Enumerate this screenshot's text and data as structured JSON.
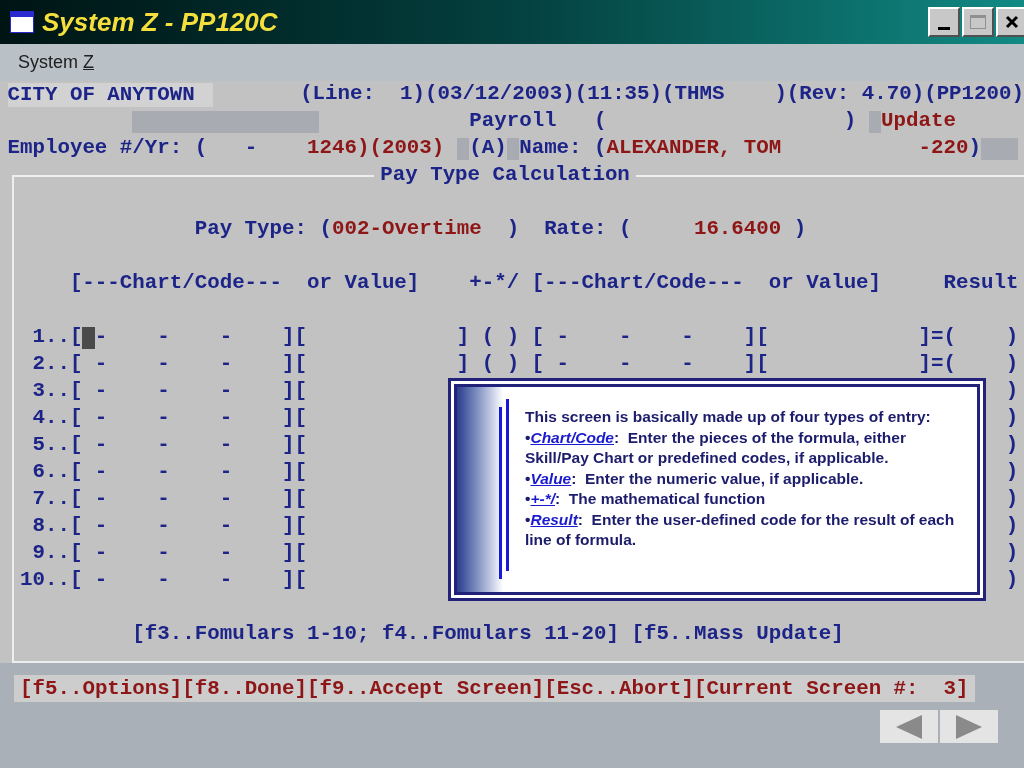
{
  "window": {
    "title": "System Z - PP120C"
  },
  "menu": [
    {
      "label": "System ",
      "mnemonic": "Z"
    }
  ],
  "header": {
    "organization": "CITY OF ANYTOWN",
    "info": "(Line:  1)(03/12/2003)(11:35)(THMS    )(Rev: 4.70)(PP1200)",
    "module": "Payroll",
    "module_open": "(",
    "module_close": ")",
    "mode": "Update"
  },
  "employee": {
    "label": "Employee #/Yr: (",
    "separator": "-",
    "number": "1246)(2003)",
    "status": "(A)",
    "name_label": "Name: (",
    "name": "ALEXANDER, TOM",
    "code": "-220",
    "close": ")"
  },
  "section": {
    "title": "Pay Type Calculation",
    "pay_type_label": "Pay Type: (",
    "pay_type": "002-Overtime",
    "pay_type_close": ")",
    "rate_label": "Rate: (",
    "rate": "16.6400",
    "rate_close": ")"
  },
  "columns": [
    "[---Chart/Code---  or Value]",
    "+-*/",
    "[---Chart/Code---  or Value]",
    "Result"
  ],
  "rows": [
    {
      "label": "1..[",
      "cursor": true,
      "left": [
        "-",
        "-",
        "-",
        "]["
      ],
      "right": [
        "]",
        "(",
        ")",
        "[",
        "-",
        "-",
        "-",
        "][",
        "]=(",
        ")"
      ]
    },
    {
      "label": "2..[",
      "cursor": false,
      "left": [
        "-",
        "-",
        "-",
        "]["
      ],
      "right": [
        "]",
        "(",
        ")",
        "[",
        "-",
        "-",
        "-",
        "][",
        "]=(",
        ")"
      ]
    },
    {
      "label": "3..[",
      "cursor": false,
      "left": [
        "-",
        "-",
        "-",
        "]["
      ],
      "right": [
        ")"
      ]
    },
    {
      "label": "4..[",
      "cursor": false,
      "left": [
        "-",
        "-",
        "-",
        "]["
      ],
      "right": [
        ")"
      ]
    },
    {
      "label": "5..[",
      "cursor": false,
      "left": [
        "-",
        "-",
        "-",
        "]["
      ],
      "right": [
        ")"
      ]
    },
    {
      "label": "6..[",
      "cursor": false,
      "left": [
        "-",
        "-",
        "-",
        "]["
      ],
      "right": [
        ")"
      ]
    },
    {
      "label": "7..[",
      "cursor": false,
      "left": [
        "-",
        "-",
        "-",
        "]["
      ],
      "right": [
        ")"
      ]
    },
    {
      "label": "8..[",
      "cursor": false,
      "left": [
        "-",
        "-",
        "-",
        "]["
      ],
      "right": [
        ")"
      ]
    },
    {
      "label": "9..[",
      "cursor": false,
      "left": [
        "-",
        "-",
        "-",
        "]["
      ],
      "right": [
        ")"
      ]
    },
    {
      "label": "10..[",
      "cursor": false,
      "left": [
        "-",
        "-",
        "-",
        "]["
      ],
      "right": [
        ")"
      ]
    }
  ],
  "function_keys": "[f3..Fomulars 1-10; f4..Fomulars 11-20] [f5..Mass Update]",
  "status_bar": "[f5..Options][f8..Done][f9..Accept Screen][Esc..Abort][Current Screen #:  3]",
  "callout": {
    "intro": "This screen is basically made up of four types of entry:",
    "bullets": [
      {
        "bullet": "•",
        "term": "Chart/Code",
        "text": ":  Enter the pieces of the formula, either Skill/Pay Chart or predefined codes, if applicable."
      },
      {
        "bullet": "•",
        "term": "Value",
        "text": ":  Enter the numeric value, if applicable."
      },
      {
        "bullet": "•",
        "term": "+-*/",
        "text": ":  The mathematical function"
      },
      {
        "bullet": "•",
        "term": "Result",
        "text": ":  Enter the user-defined code for the result of each line of formula."
      }
    ]
  }
}
